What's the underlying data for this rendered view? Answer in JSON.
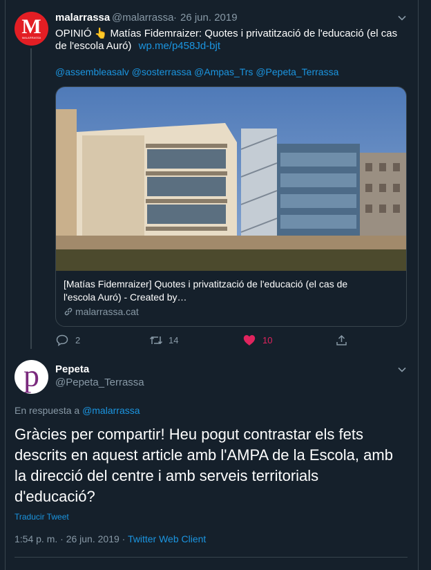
{
  "tweet1": {
    "author_name": "malarrassa",
    "author_handle": "@malarrassa",
    "separator": "·",
    "date": "26 jun. 2019",
    "avatar_letter": "M",
    "avatar_small": "MALARRASSA",
    "text_line1": "OPINIÓ",
    "emoji": "👆",
    "text_line1_rest": "Matías Fidemraizer: Quotes i privatització de l'educació (el cas",
    "text_line2": "de l'escola Auró)",
    "link": "wp.me/p458Jd-bjt",
    "mentions": "@assembleasalv @sosterrassa @Ampas_Trs @Pepeta_Terrassa",
    "card": {
      "title_line1": "[Matías Fidemraizer] Quotes i privatització de l'educació (el cas de",
      "title_line2": "l'escola Auró) - Created by…",
      "domain": "malarrassa.cat"
    },
    "actions": {
      "replies": "2",
      "retweets": "14",
      "likes": "10"
    }
  },
  "tweet2": {
    "author_name": "Pepeta",
    "author_handle": "@Pepeta_Terrassa",
    "avatar_letter": "p",
    "reply_prefix": "En respuesta a",
    "reply_to": "@malarrassa",
    "text_lines": [
      "Gràcies per compartir! Heu pogut contrastar els fets",
      "descrits en aquest article amb l'AMPA de la Escola, amb",
      "la direcció del centre i amb serveis territorials",
      "d'educació?"
    ],
    "translate": "Traducir Tweet",
    "timestamp": "1:54 p. m. · 26 jun. 2019 ·",
    "client": "Twitter Web Client"
  },
  "colors": {
    "background": "#15202b",
    "border": "#38444d",
    "muted": "#8899a6",
    "link": "#1b95e0",
    "like": "#e0245e",
    "brand_red": "#e31e24",
    "pepeta_purple": "#7a2a7d"
  }
}
